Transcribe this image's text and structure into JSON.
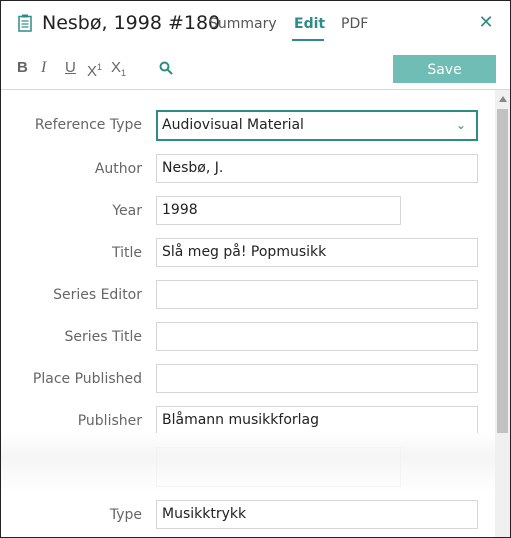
{
  "header": {
    "reference_title": "Nesbø, 1998 #180",
    "tabs": [
      "Summary",
      "Edit",
      "PDF"
    ],
    "active_tab": "Edit",
    "close_icon": "close-icon"
  },
  "toolbar": {
    "bold": "B",
    "italic": "I",
    "underline": "U",
    "superscript": "X",
    "superscript_mark": "1",
    "subscript": "X",
    "subscript_mark": "1",
    "search_icon": "search-icon",
    "save_label": "Save"
  },
  "form": {
    "reference_type": {
      "label": "Reference Type",
      "value": "Audiovisual Material"
    },
    "author": {
      "label": "Author",
      "value": "Nesbø, J."
    },
    "year": {
      "label": "Year",
      "value": "1998"
    },
    "title": {
      "label": "Title",
      "value": "Slå meg på! Popmusikk"
    },
    "series_editor": {
      "label": "Series Editor",
      "value": ""
    },
    "series_title": {
      "label": "Series Title",
      "value": ""
    },
    "place_published": {
      "label": "Place Published",
      "value": ""
    },
    "publisher": {
      "label": "Publisher",
      "value": "Blåmann musikkforlag"
    },
    "type": {
      "label": "Type",
      "value": "Musikktrykk"
    }
  },
  "colors": {
    "accent": "#2e8b85",
    "save_button": "#6fbdb4",
    "label_text": "#666666"
  }
}
